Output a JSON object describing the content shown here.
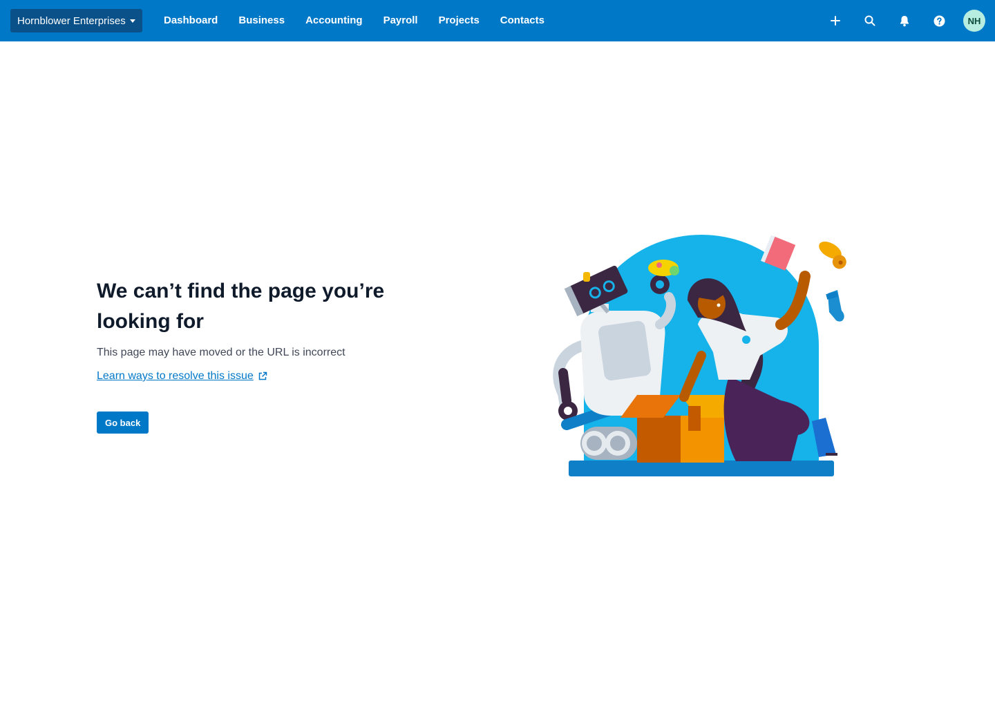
{
  "header": {
    "org_name": "Hornblower Enterprises",
    "nav": [
      "Dashboard",
      "Business",
      "Accounting",
      "Payroll",
      "Projects",
      "Contacts"
    ],
    "avatar_initials": "NH",
    "brand_color": "#0078c8"
  },
  "main": {
    "title": "We can’t find the page you’re looking for",
    "description": "This page may have moved or the URL is incorrect",
    "help_link": "Learn ways to resolve this issue",
    "back_button": "Go back"
  }
}
